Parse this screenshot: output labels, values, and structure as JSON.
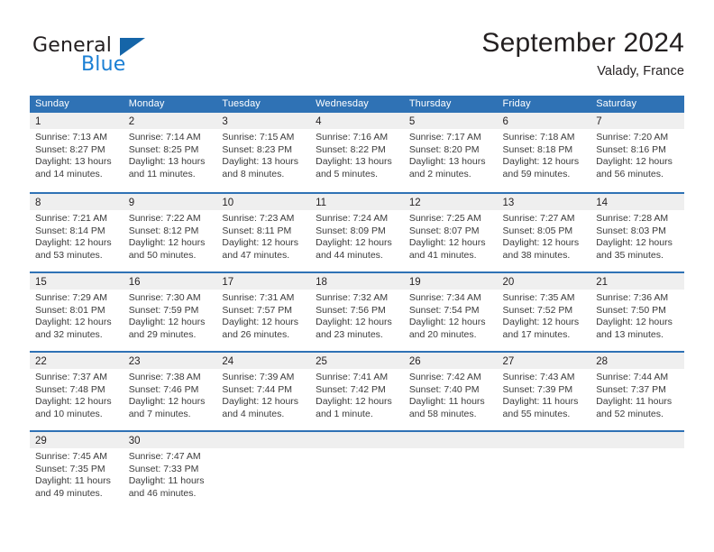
{
  "brand": {
    "name_part1": "General",
    "name_part2": "Blue",
    "logo_icon": "triangle-logo-icon"
  },
  "header": {
    "month_title": "September 2024",
    "location": "Valady, France"
  },
  "calendar": {
    "accent_color": "#2f72b5",
    "day_band_color": "#efefef",
    "weekday_headers": [
      "Sunday",
      "Monday",
      "Tuesday",
      "Wednesday",
      "Thursday",
      "Friday",
      "Saturday"
    ],
    "weeks": [
      [
        {
          "day": "1",
          "sunrise": "Sunrise: 7:13 AM",
          "sunset": "Sunset: 8:27 PM",
          "daylight_l1": "Daylight: 13 hours",
          "daylight_l2": "and 14 minutes."
        },
        {
          "day": "2",
          "sunrise": "Sunrise: 7:14 AM",
          "sunset": "Sunset: 8:25 PM",
          "daylight_l1": "Daylight: 13 hours",
          "daylight_l2": "and 11 minutes."
        },
        {
          "day": "3",
          "sunrise": "Sunrise: 7:15 AM",
          "sunset": "Sunset: 8:23 PM",
          "daylight_l1": "Daylight: 13 hours",
          "daylight_l2": "and 8 minutes."
        },
        {
          "day": "4",
          "sunrise": "Sunrise: 7:16 AM",
          "sunset": "Sunset: 8:22 PM",
          "daylight_l1": "Daylight: 13 hours",
          "daylight_l2": "and 5 minutes."
        },
        {
          "day": "5",
          "sunrise": "Sunrise: 7:17 AM",
          "sunset": "Sunset: 8:20 PM",
          "daylight_l1": "Daylight: 13 hours",
          "daylight_l2": "and 2 minutes."
        },
        {
          "day": "6",
          "sunrise": "Sunrise: 7:18 AM",
          "sunset": "Sunset: 8:18 PM",
          "daylight_l1": "Daylight: 12 hours",
          "daylight_l2": "and 59 minutes."
        },
        {
          "day": "7",
          "sunrise": "Sunrise: 7:20 AM",
          "sunset": "Sunset: 8:16 PM",
          "daylight_l1": "Daylight: 12 hours",
          "daylight_l2": "and 56 minutes."
        }
      ],
      [
        {
          "day": "8",
          "sunrise": "Sunrise: 7:21 AM",
          "sunset": "Sunset: 8:14 PM",
          "daylight_l1": "Daylight: 12 hours",
          "daylight_l2": "and 53 minutes."
        },
        {
          "day": "9",
          "sunrise": "Sunrise: 7:22 AM",
          "sunset": "Sunset: 8:12 PM",
          "daylight_l1": "Daylight: 12 hours",
          "daylight_l2": "and 50 minutes."
        },
        {
          "day": "10",
          "sunrise": "Sunrise: 7:23 AM",
          "sunset": "Sunset: 8:11 PM",
          "daylight_l1": "Daylight: 12 hours",
          "daylight_l2": "and 47 minutes."
        },
        {
          "day": "11",
          "sunrise": "Sunrise: 7:24 AM",
          "sunset": "Sunset: 8:09 PM",
          "daylight_l1": "Daylight: 12 hours",
          "daylight_l2": "and 44 minutes."
        },
        {
          "day": "12",
          "sunrise": "Sunrise: 7:25 AM",
          "sunset": "Sunset: 8:07 PM",
          "daylight_l1": "Daylight: 12 hours",
          "daylight_l2": "and 41 minutes."
        },
        {
          "day": "13",
          "sunrise": "Sunrise: 7:27 AM",
          "sunset": "Sunset: 8:05 PM",
          "daylight_l1": "Daylight: 12 hours",
          "daylight_l2": "and 38 minutes."
        },
        {
          "day": "14",
          "sunrise": "Sunrise: 7:28 AM",
          "sunset": "Sunset: 8:03 PM",
          "daylight_l1": "Daylight: 12 hours",
          "daylight_l2": "and 35 minutes."
        }
      ],
      [
        {
          "day": "15",
          "sunrise": "Sunrise: 7:29 AM",
          "sunset": "Sunset: 8:01 PM",
          "daylight_l1": "Daylight: 12 hours",
          "daylight_l2": "and 32 minutes."
        },
        {
          "day": "16",
          "sunrise": "Sunrise: 7:30 AM",
          "sunset": "Sunset: 7:59 PM",
          "daylight_l1": "Daylight: 12 hours",
          "daylight_l2": "and 29 minutes."
        },
        {
          "day": "17",
          "sunrise": "Sunrise: 7:31 AM",
          "sunset": "Sunset: 7:57 PM",
          "daylight_l1": "Daylight: 12 hours",
          "daylight_l2": "and 26 minutes."
        },
        {
          "day": "18",
          "sunrise": "Sunrise: 7:32 AM",
          "sunset": "Sunset: 7:56 PM",
          "daylight_l1": "Daylight: 12 hours",
          "daylight_l2": "and 23 minutes."
        },
        {
          "day": "19",
          "sunrise": "Sunrise: 7:34 AM",
          "sunset": "Sunset: 7:54 PM",
          "daylight_l1": "Daylight: 12 hours",
          "daylight_l2": "and 20 minutes."
        },
        {
          "day": "20",
          "sunrise": "Sunrise: 7:35 AM",
          "sunset": "Sunset: 7:52 PM",
          "daylight_l1": "Daylight: 12 hours",
          "daylight_l2": "and 17 minutes."
        },
        {
          "day": "21",
          "sunrise": "Sunrise: 7:36 AM",
          "sunset": "Sunset: 7:50 PM",
          "daylight_l1": "Daylight: 12 hours",
          "daylight_l2": "and 13 minutes."
        }
      ],
      [
        {
          "day": "22",
          "sunrise": "Sunrise: 7:37 AM",
          "sunset": "Sunset: 7:48 PM",
          "daylight_l1": "Daylight: 12 hours",
          "daylight_l2": "and 10 minutes."
        },
        {
          "day": "23",
          "sunrise": "Sunrise: 7:38 AM",
          "sunset": "Sunset: 7:46 PM",
          "daylight_l1": "Daylight: 12 hours",
          "daylight_l2": "and 7 minutes."
        },
        {
          "day": "24",
          "sunrise": "Sunrise: 7:39 AM",
          "sunset": "Sunset: 7:44 PM",
          "daylight_l1": "Daylight: 12 hours",
          "daylight_l2": "and 4 minutes."
        },
        {
          "day": "25",
          "sunrise": "Sunrise: 7:41 AM",
          "sunset": "Sunset: 7:42 PM",
          "daylight_l1": "Daylight: 12 hours",
          "daylight_l2": "and 1 minute."
        },
        {
          "day": "26",
          "sunrise": "Sunrise: 7:42 AM",
          "sunset": "Sunset: 7:40 PM",
          "daylight_l1": "Daylight: 11 hours",
          "daylight_l2": "and 58 minutes."
        },
        {
          "day": "27",
          "sunrise": "Sunrise: 7:43 AM",
          "sunset": "Sunset: 7:39 PM",
          "daylight_l1": "Daylight: 11 hours",
          "daylight_l2": "and 55 minutes."
        },
        {
          "day": "28",
          "sunrise": "Sunrise: 7:44 AM",
          "sunset": "Sunset: 7:37 PM",
          "daylight_l1": "Daylight: 11 hours",
          "daylight_l2": "and 52 minutes."
        }
      ],
      [
        {
          "day": "29",
          "sunrise": "Sunrise: 7:45 AM",
          "sunset": "Sunset: 7:35 PM",
          "daylight_l1": "Daylight: 11 hours",
          "daylight_l2": "and 49 minutes."
        },
        {
          "day": "30",
          "sunrise": "Sunrise: 7:47 AM",
          "sunset": "Sunset: 7:33 PM",
          "daylight_l1": "Daylight: 11 hours",
          "daylight_l2": "and 46 minutes."
        },
        {
          "day": "",
          "sunrise": "",
          "sunset": "",
          "daylight_l1": "",
          "daylight_l2": ""
        },
        {
          "day": "",
          "sunrise": "",
          "sunset": "",
          "daylight_l1": "",
          "daylight_l2": ""
        },
        {
          "day": "",
          "sunrise": "",
          "sunset": "",
          "daylight_l1": "",
          "daylight_l2": ""
        },
        {
          "day": "",
          "sunrise": "",
          "sunset": "",
          "daylight_l1": "",
          "daylight_l2": ""
        },
        {
          "day": "",
          "sunrise": "",
          "sunset": "",
          "daylight_l1": "",
          "daylight_l2": ""
        }
      ]
    ]
  }
}
